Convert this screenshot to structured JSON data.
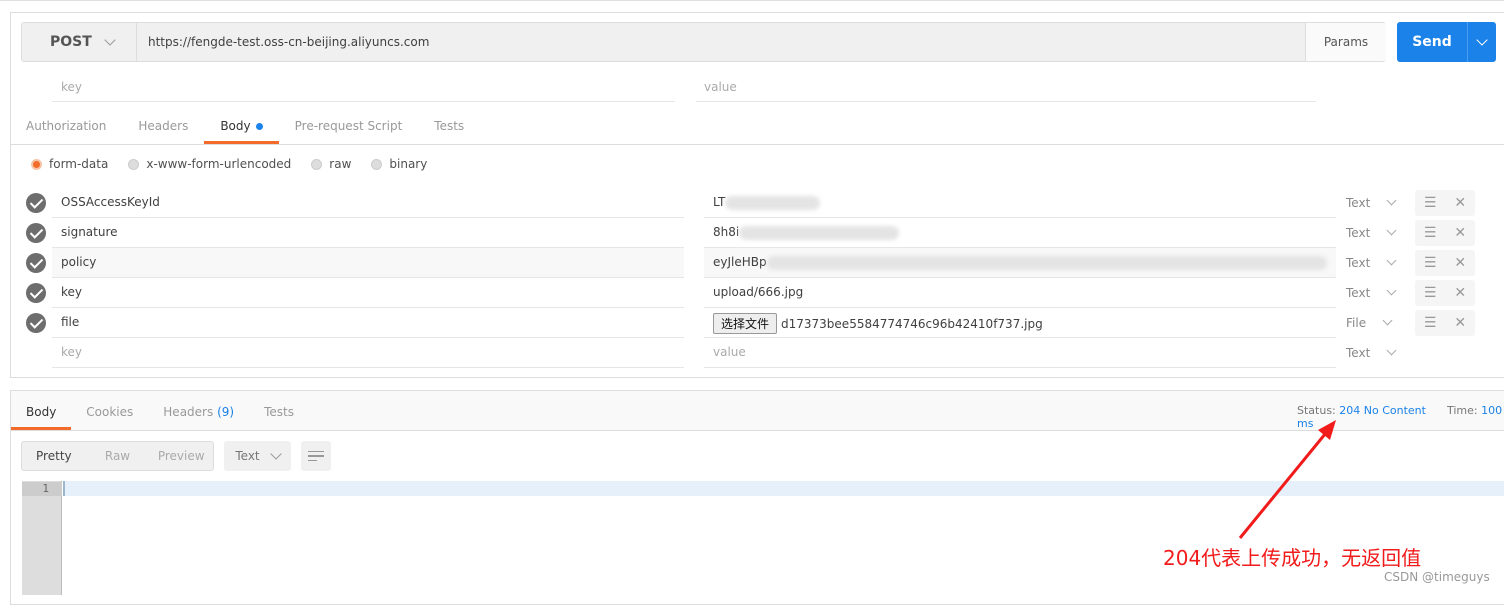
{
  "request": {
    "method": "POST",
    "url": "https://fengde-test.oss-cn-beijing.aliyuncs.com",
    "params_label": "Params",
    "send_label": "Send",
    "param_key_placeholder": "key",
    "param_value_placeholder": "value"
  },
  "tabs": [
    {
      "label": "Authorization"
    },
    {
      "label": "Headers"
    },
    {
      "label": "Body",
      "active": true
    },
    {
      "label": "Pre-request Script"
    },
    {
      "label": "Tests"
    }
  ],
  "body_modes": [
    {
      "label": "form-data",
      "selected": true
    },
    {
      "label": "x-www-form-urlencoded"
    },
    {
      "label": "raw"
    },
    {
      "label": "binary"
    }
  ],
  "form_rows": [
    {
      "key": "OSSAccessKeyId",
      "value": "LT",
      "redacted": true,
      "type": "Text"
    },
    {
      "key": "signature",
      "value": "8h8i",
      "redacted": true,
      "type": "Text"
    },
    {
      "key": "policy",
      "value": "eyJleHBp",
      "redacted": true,
      "type": "Text"
    },
    {
      "key": "key",
      "value": "upload/666.jpg",
      "type": "Text"
    },
    {
      "key": "file",
      "file_button": "选择文件",
      "value": "d17373bee5584774746c96b42410f737.jpg",
      "type": "File"
    }
  ],
  "new_row": {
    "key_placeholder": "key",
    "value_placeholder": "value",
    "type": "Text"
  },
  "response": {
    "tabs": [
      {
        "label": "Body",
        "active": true
      },
      {
        "label": "Cookies"
      },
      {
        "label": "Headers",
        "count": "(9)"
      },
      {
        "label": "Tests"
      }
    ],
    "status_label": "Status:",
    "status_value": "204 No Content",
    "time_label": "Time:",
    "time_value": "100 ms",
    "views": [
      "Pretty",
      "Raw",
      "Preview"
    ],
    "format": "Text",
    "line_number": "1"
  },
  "annotation": {
    "text": "204代表上传成功，无返回值",
    "color": "#f21b1b"
  },
  "watermark": "CSDN @timeguys",
  "colors": {
    "accent": "#f26b2a",
    "send": "#1a82e8"
  }
}
